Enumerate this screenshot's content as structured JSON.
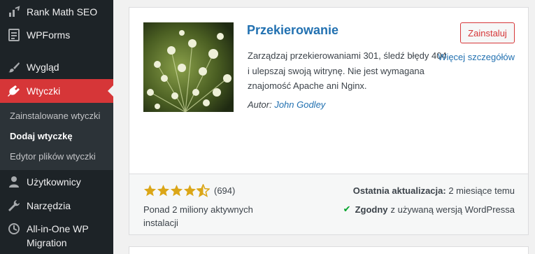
{
  "sidebar": {
    "items": [
      {
        "label": "Rank Math SEO",
        "icon": "rank-math-icon"
      },
      {
        "label": "WPForms",
        "icon": "wpforms-icon"
      },
      {
        "label": "Wygląd",
        "icon": "paintbrush-icon"
      },
      {
        "label": "Wtyczki",
        "icon": "plugin-icon"
      },
      {
        "label": "Użytkownicy",
        "icon": "users-icon"
      },
      {
        "label": "Narzędzia",
        "icon": "wrench-icon"
      },
      {
        "label": "All-in-One WP Migration",
        "label_line1": "All-in-One WP",
        "label_line2": "Migration",
        "icon": "migration-icon"
      }
    ],
    "submenu": [
      {
        "label": "Zainstalowane wtyczki"
      },
      {
        "label": "Dodaj wtyczkę"
      },
      {
        "label": "Edytor plików wtyczki"
      }
    ],
    "accent": "#d63638"
  },
  "plugin": {
    "name": "Przekierowanie",
    "description": "Zarządzaj przekierowaniami 301, śledź błędy 404 i ulepszaj swoją witrynę. Nie jest wymagana znajomość Apache ani Nginx.",
    "author_prefix": "Autor:",
    "author": "John Godley",
    "install_label": "Zainstaluj",
    "more_details_label": "Więcej szczegółów",
    "rating": 4.5,
    "rating_count": "(694)",
    "installs": "Ponad 2 miliony aktywnych instalacji",
    "last_updated_label": "Ostatnia aktualizacja:",
    "last_updated_value": "2 miesiące temu",
    "compat_label": "Zgodny",
    "compat_text": "z używaną wersją WordPressa"
  }
}
